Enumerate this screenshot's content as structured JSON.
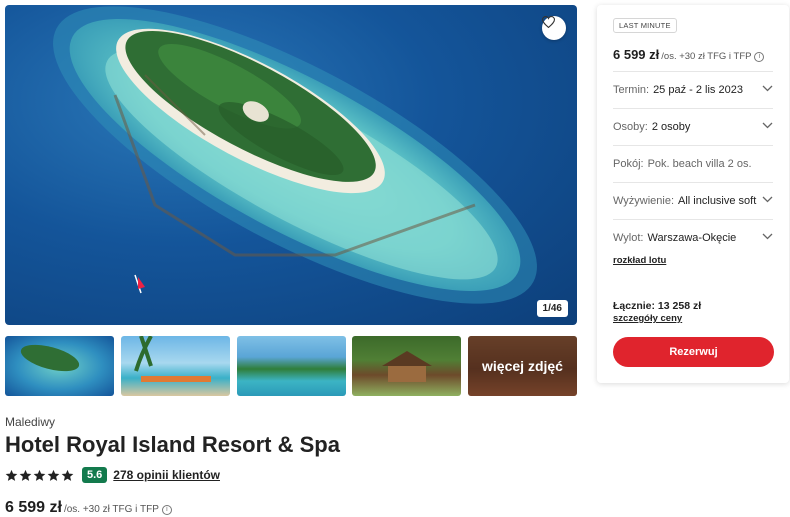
{
  "gallery": {
    "counter": "1/46",
    "more_photos_label": "więcej zdjęć",
    "favorite_icon": "heart-icon"
  },
  "hotel": {
    "location": "Malediwy",
    "name": "Hotel Royal Island Resort & Spa",
    "stars": 5,
    "score": "5.6",
    "reviews_link": "278 opinii klientów",
    "price": "6 599 zł",
    "price_suffix": "/os. +30 zł TFG i TFP"
  },
  "booking": {
    "badge": "LAST MINUTE",
    "price": "6 599 zł",
    "price_suffix": "/os. +30 zł TFG i TFP",
    "fields": [
      {
        "label": "Termin:",
        "value": "25 paź - 2 lis 2023",
        "dropdown": true
      },
      {
        "label": "Osoby:",
        "value": "2 osoby",
        "dropdown": true
      },
      {
        "label": "Pokój:",
        "value": "Pok. beach villa 2 os.",
        "dropdown": false
      },
      {
        "label": "Wyżywienie:",
        "value": "All inclusive soft",
        "dropdown": true
      },
      {
        "label": "Wylot:",
        "value": "Warszawa-Okęcie",
        "dropdown": true
      }
    ],
    "flight_schedule_link": "rozkład lotu",
    "total": "Łącznie: 13 258 zł",
    "price_details_link": "szczegóły ceny",
    "reserve_label": "Rezerwuj"
  },
  "colors": {
    "accent_red": "#e0242d",
    "score_green": "#137a4d"
  }
}
